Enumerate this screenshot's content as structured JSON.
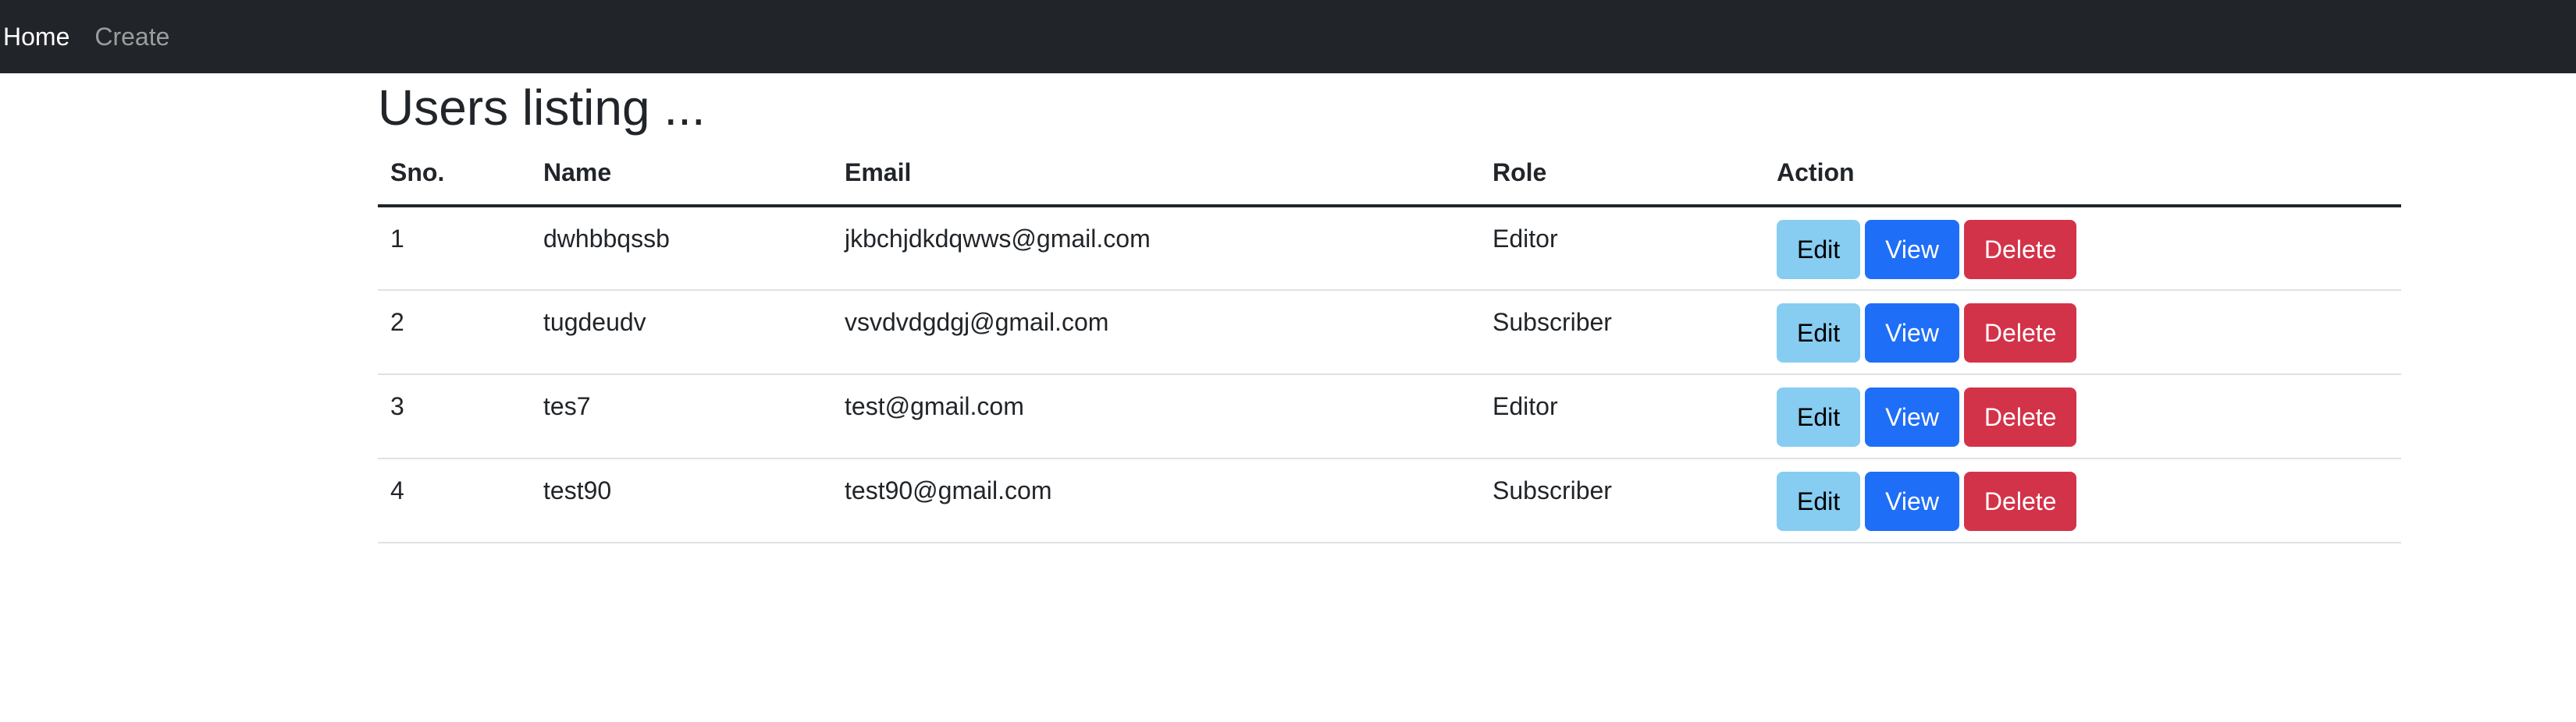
{
  "nav": {
    "items": [
      {
        "label": "Home"
      },
      {
        "label": "Create"
      }
    ]
  },
  "page": {
    "title": "Users listing ..."
  },
  "table": {
    "headers": [
      "Sno.",
      "Name",
      "Email",
      "Role",
      "Action"
    ],
    "rows": [
      {
        "sno": "1",
        "name": "dwhbbqssb",
        "email": "jkbchjdkdqwws@gmail.com",
        "role": "Editor"
      },
      {
        "sno": "2",
        "name": "tugdeudv",
        "email": "vsvdvdgdgj@gmail.com",
        "role": "Subscriber"
      },
      {
        "sno": "3",
        "name": "tes7",
        "email": "test@gmail.com",
        "role": "Editor"
      },
      {
        "sno": "4",
        "name": "test90",
        "email": "test90@gmail.com",
        "role": "Subscriber"
      }
    ]
  },
  "actions": {
    "edit_label": "Edit",
    "view_label": "View",
    "delete_label": "Delete"
  },
  "colors": {
    "navbar": "#212529",
    "edit": "#87ccf1",
    "view": "#1f6ef7",
    "delete": "#d33349"
  }
}
